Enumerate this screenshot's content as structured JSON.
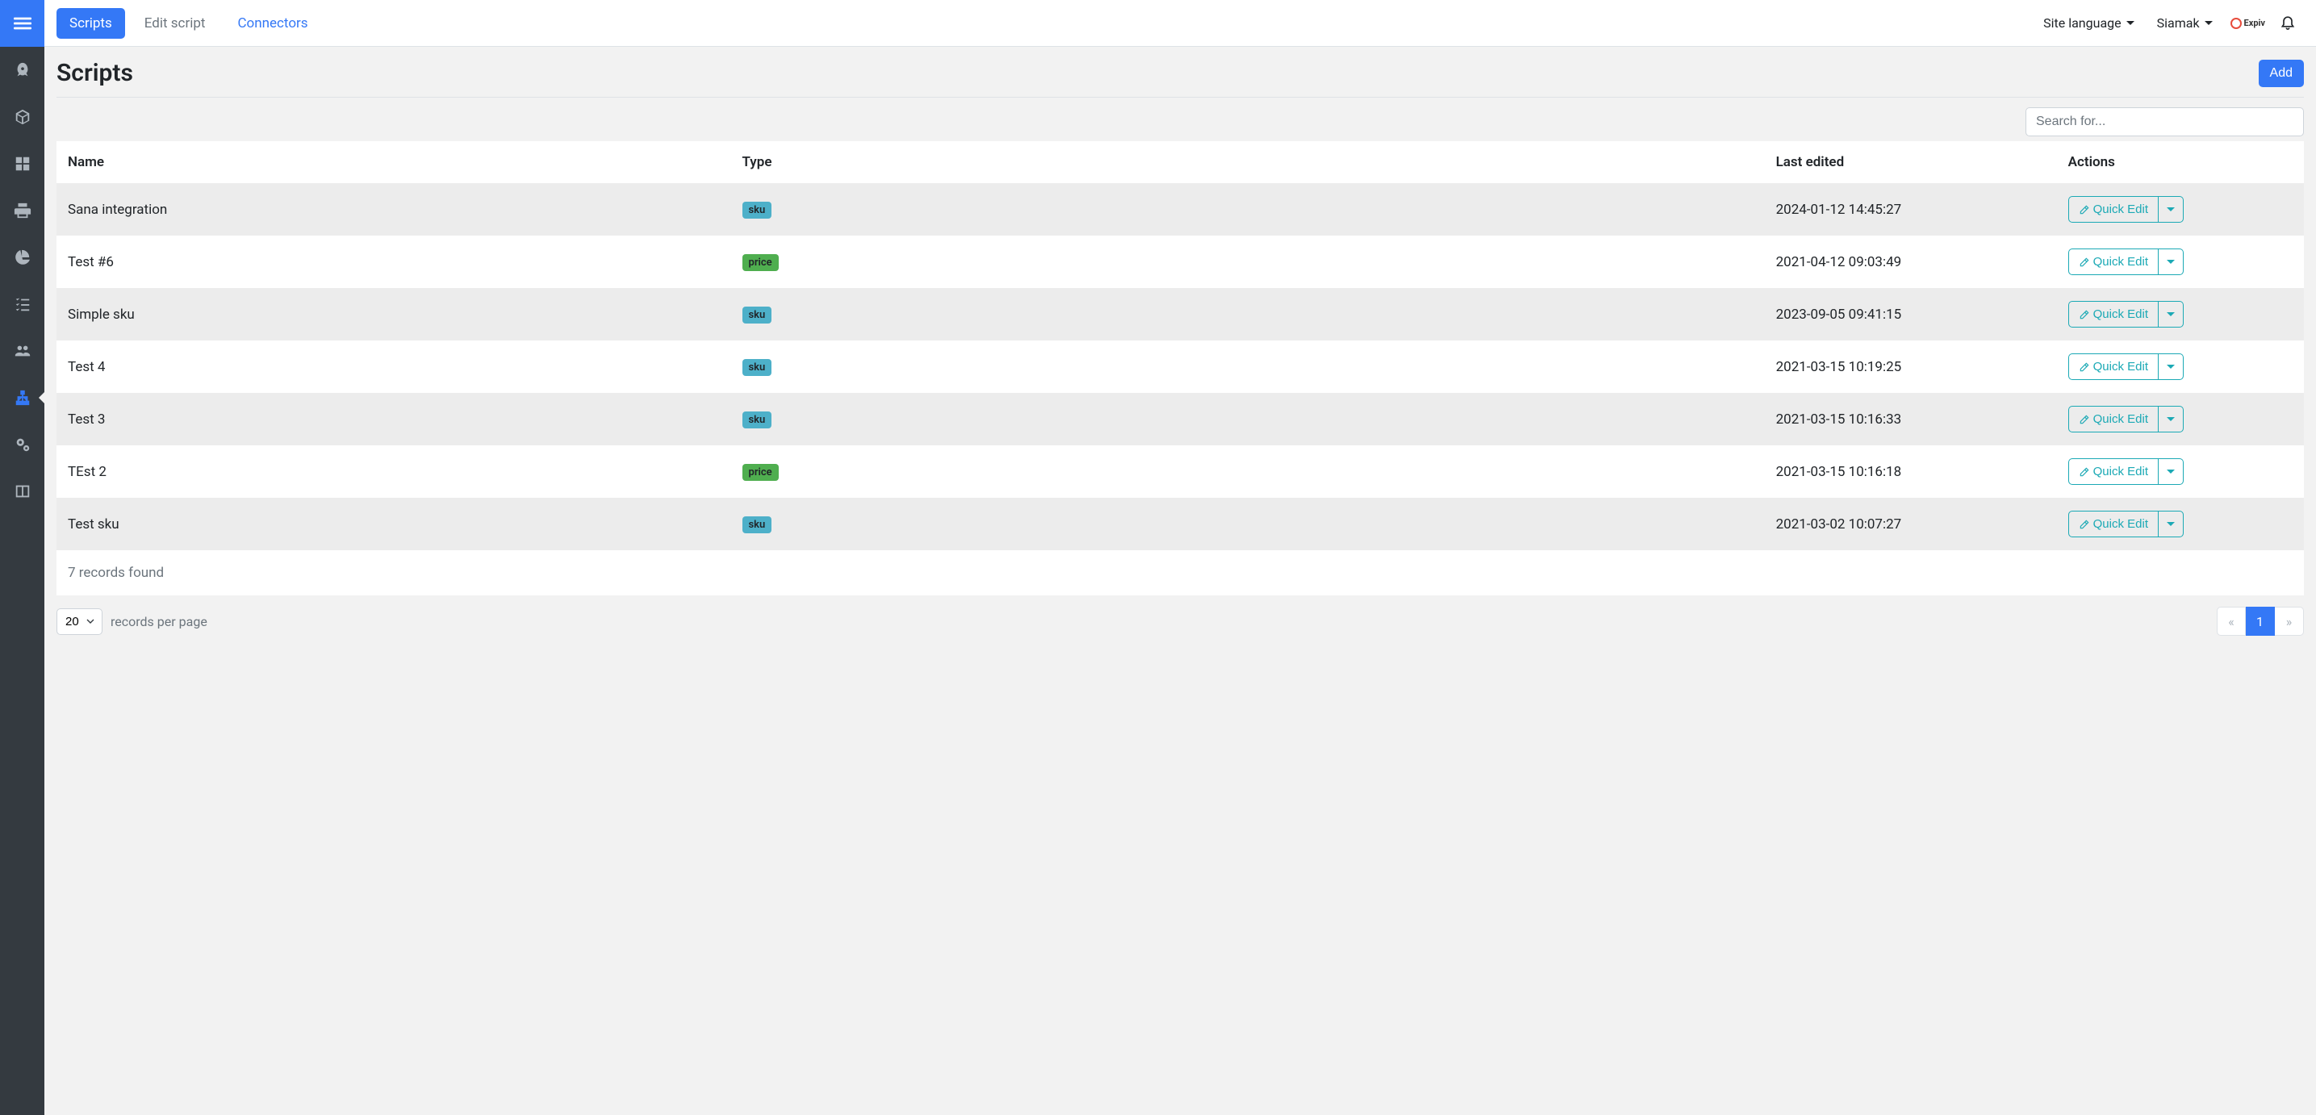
{
  "topbar": {
    "tabs": [
      {
        "label": "Scripts",
        "state": "active"
      },
      {
        "label": "Edit script",
        "state": "muted"
      },
      {
        "label": "Connectors",
        "state": "link"
      }
    ],
    "site_language_label": "Site language",
    "user_name": "Siamak",
    "brand": "Expiv"
  },
  "page": {
    "title": "Scripts",
    "add_button": "Add",
    "search_placeholder": "Search for..."
  },
  "table": {
    "columns": {
      "name": "Name",
      "type": "Type",
      "last_edited": "Last edited",
      "actions": "Actions"
    },
    "quick_edit_label": "Quick Edit",
    "rows": [
      {
        "name": "Sana integration",
        "type": "sku",
        "last_edited": "2024-01-12 14:45:27"
      },
      {
        "name": "Test #6",
        "type": "price",
        "last_edited": "2021-04-12 09:03:49"
      },
      {
        "name": "Simple sku",
        "type": "sku",
        "last_edited": "2023-09-05 09:41:15"
      },
      {
        "name": "Test 4",
        "type": "sku",
        "last_edited": "2021-03-15 10:19:25"
      },
      {
        "name": "Test 3",
        "type": "sku",
        "last_edited": "2021-03-15 10:16:33"
      },
      {
        "name": "TEst 2",
        "type": "price",
        "last_edited": "2021-03-15 10:16:18"
      },
      {
        "name": "Test sku",
        "type": "sku",
        "last_edited": "2021-03-02 10:07:27"
      }
    ],
    "records_found": "7 records found"
  },
  "pagination": {
    "per_page_value": "20",
    "per_page_label": "records per page",
    "prev": "«",
    "pages": [
      "1"
    ],
    "next": "»"
  }
}
